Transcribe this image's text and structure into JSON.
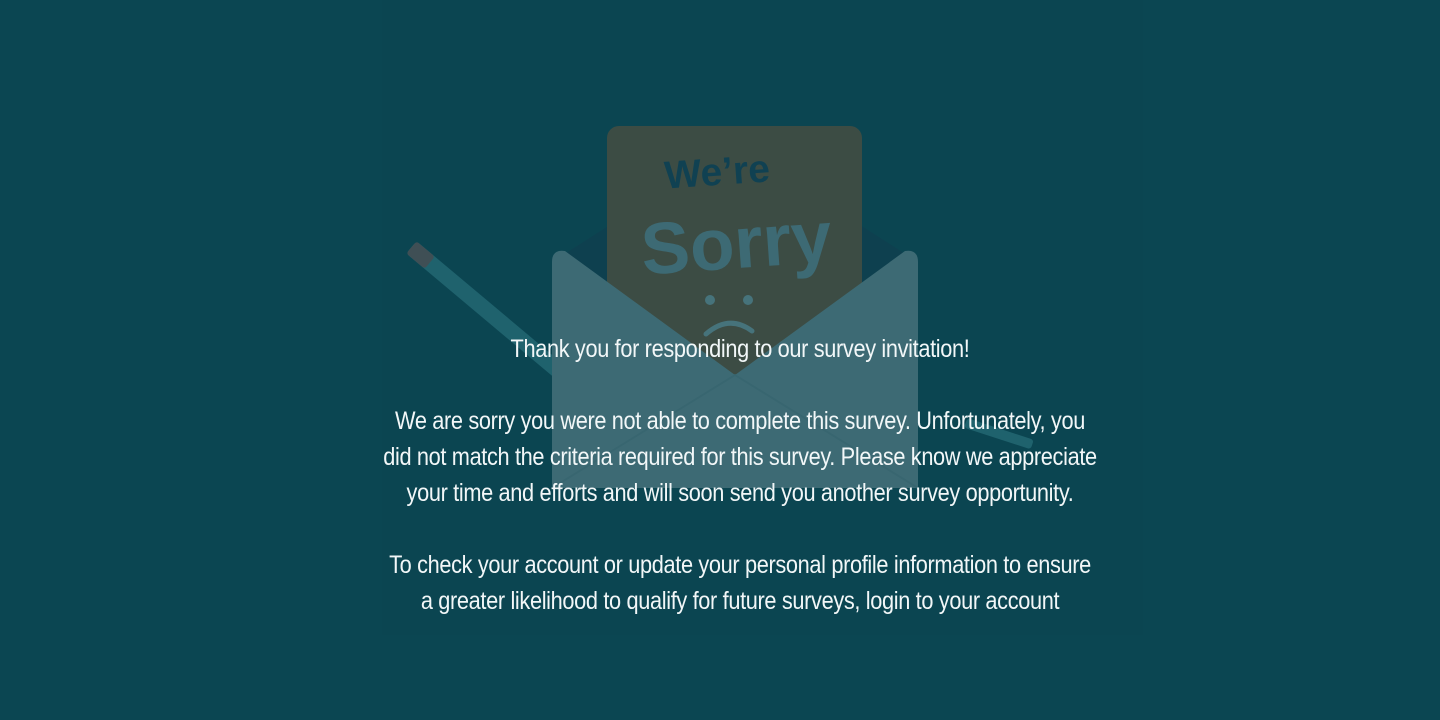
{
  "page": {
    "background_color": "#0b4652"
  },
  "illustration": {
    "icon": "sorry-envelope-illustration",
    "card_top": "We’re",
    "card_main": "Sorry",
    "face": ":(",
    "colors": {
      "card": "#d4621d",
      "envelope": "#d9dde0",
      "envelope_dark": "#17324a",
      "text_dark": "#1f3555",
      "pencil": "#5dbcc6",
      "pencil_tip": "#e26f62"
    }
  },
  "message": {
    "headline": "Thank you for responding to our survey invitation!",
    "body_lines": [
      "We are sorry you were not able to complete this survey. Unfortunately, you",
      "did not match the criteria required for this survey. Please know we appreciate",
      "your time and efforts and will soon send you another survey opportunity."
    ],
    "account_lines": [
      "To check your account or update your personal profile information to ensure",
      "a greater likelihood to qualify for future surveys, login to your account"
    ]
  }
}
